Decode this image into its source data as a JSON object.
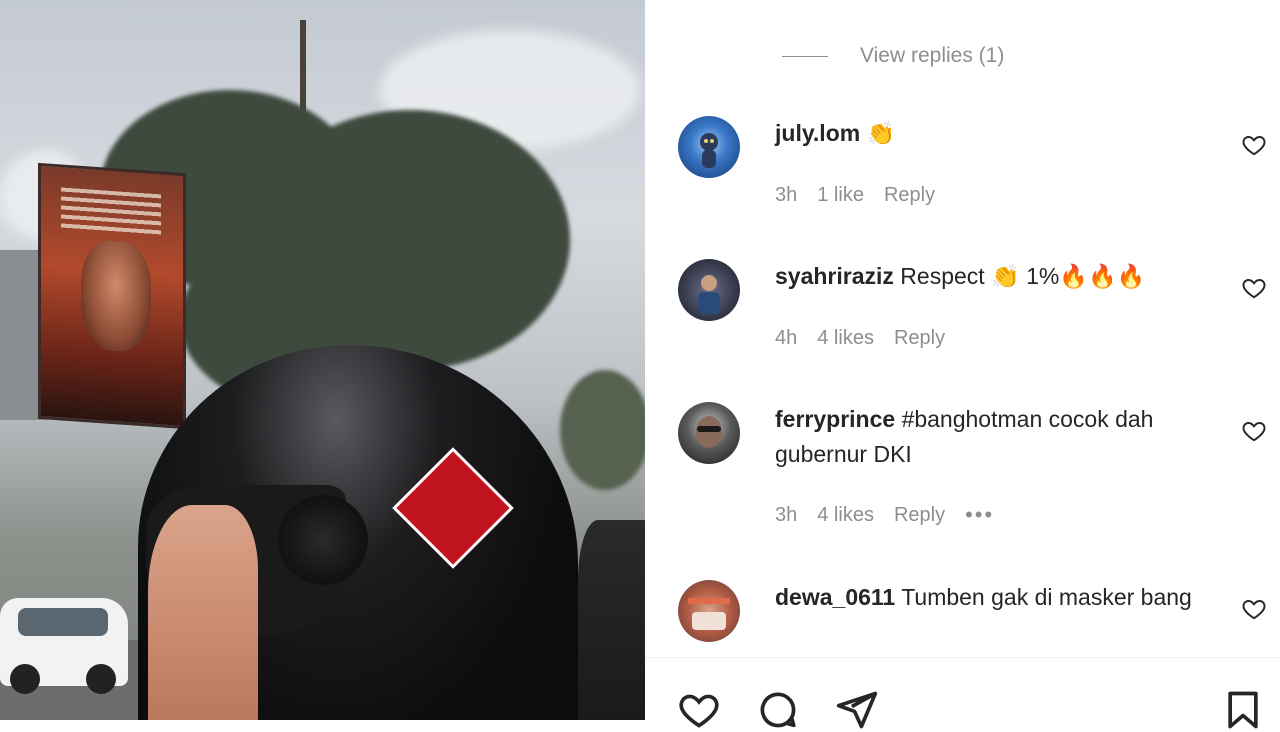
{
  "post": {
    "view_replies_label": "View replies (1)"
  },
  "comments": [
    {
      "username": "july.lom",
      "text": "👏",
      "time": "3h",
      "likes": "1 like",
      "reply_label": "Reply",
      "avatar_color": "#1e4a8a"
    },
    {
      "username": "syahriraziz",
      "text": "Respect 👏 1%🔥🔥🔥",
      "time": "4h",
      "likes": "4 likes",
      "reply_label": "Reply",
      "avatar_color": "#3a3a48"
    },
    {
      "username": "ferryprince",
      "text": "#banghotman cocok dah gubernur DKI",
      "time": "3h",
      "likes": "4 likes",
      "reply_label": "Reply",
      "more_label": "•••",
      "avatar_color": "#2a2a2a"
    },
    {
      "username": "dewa_0611",
      "text": "Tumben gak di masker bang",
      "avatar_color": "#9a4a3a"
    }
  ],
  "icons": {
    "comment_like": "heart-outline-icon",
    "like": "heart-icon",
    "comment": "comment-bubble-icon",
    "share": "paper-plane-icon",
    "save": "bookmark-icon"
  },
  "colors": {
    "text_primary": "#262626",
    "text_secondary": "#8e8e8e",
    "background": "#ffffff"
  }
}
